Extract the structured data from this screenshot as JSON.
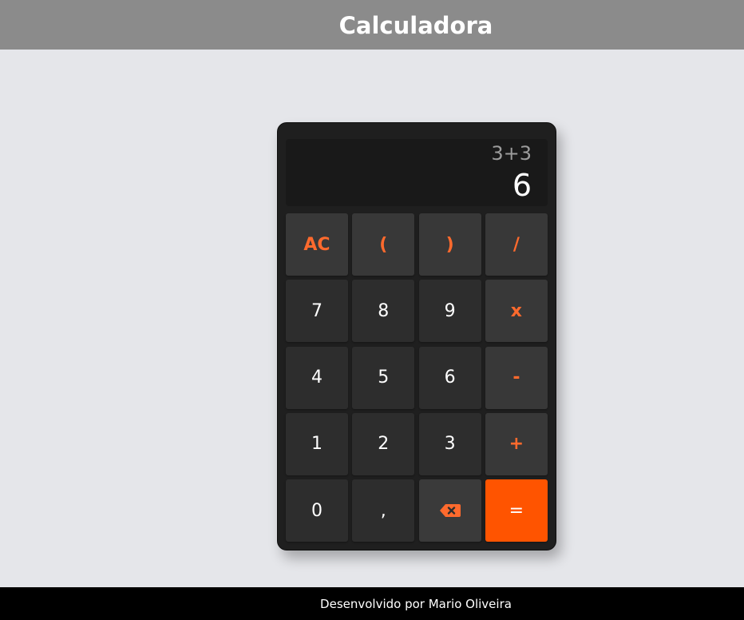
{
  "header": {
    "title": "Calculadora"
  },
  "display": {
    "expression": "3+3",
    "result": "6"
  },
  "keys": [
    {
      "label": "AC",
      "kind": "func"
    },
    {
      "label": "(",
      "kind": "func"
    },
    {
      "label": ")",
      "kind": "func"
    },
    {
      "label": "/",
      "kind": "func"
    },
    {
      "label": "7",
      "kind": "num"
    },
    {
      "label": "8",
      "kind": "num"
    },
    {
      "label": "9",
      "kind": "num"
    },
    {
      "label": "x",
      "kind": "func"
    },
    {
      "label": "4",
      "kind": "num"
    },
    {
      "label": "5",
      "kind": "num"
    },
    {
      "label": "6",
      "kind": "num"
    },
    {
      "label": "-",
      "kind": "func"
    },
    {
      "label": "1",
      "kind": "num"
    },
    {
      "label": "2",
      "kind": "num"
    },
    {
      "label": "3",
      "kind": "num"
    },
    {
      "label": "+",
      "kind": "func"
    },
    {
      "label": "0",
      "kind": "num"
    },
    {
      "label": ",",
      "kind": "num"
    },
    {
      "icon": "backspace-icon",
      "kind": "back"
    },
    {
      "label": "=",
      "kind": "equals"
    }
  ],
  "colors": {
    "accent": "#ff5400",
    "operator_text": "#ff6a2d",
    "header_bg": "#8b8b8b",
    "page_bg": "#e5e6ea",
    "calculator_bg": "#1f1f1f"
  },
  "footer": {
    "text": "Desenvolvido por Mario Oliveira"
  }
}
